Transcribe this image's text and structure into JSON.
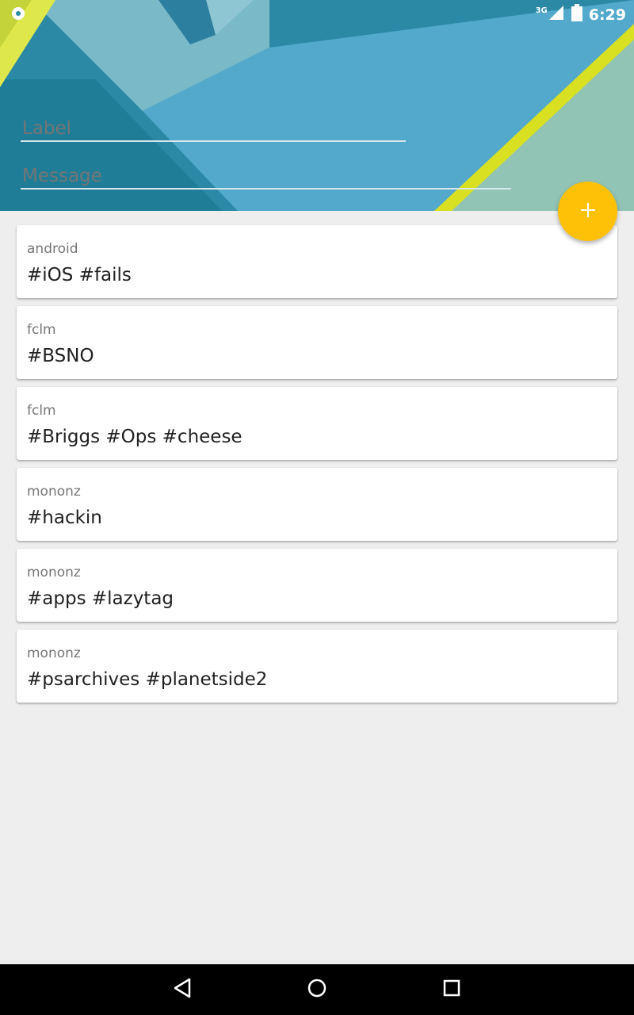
{
  "status_bar": {
    "time": "6:29",
    "network": "3G",
    "icons": [
      "notification-icon",
      "signal-icon",
      "battery-icon"
    ]
  },
  "form": {
    "label_placeholder": "Label",
    "message_placeholder": "Message"
  },
  "fab": {
    "icon": "add-icon",
    "color": "#ffc107"
  },
  "notes": [
    {
      "label": "android",
      "message": "#iOS #fails"
    },
    {
      "label": "fclm",
      "message": "#BSNO"
    },
    {
      "label": "fclm",
      "message": "#Briggs #Ops #cheese"
    },
    {
      "label": "mononz",
      "message": "#hackin"
    },
    {
      "label": "mononz",
      "message": "#apps #lazytag"
    },
    {
      "label": "mononz",
      "message": "#psarchives #planetside2"
    }
  ],
  "nav": {
    "icons": [
      "back-icon",
      "home-icon",
      "recents-icon"
    ]
  },
  "colors": {
    "accent": "#ffc107",
    "header": "#2a8aa8",
    "background": "#eeeeee"
  }
}
